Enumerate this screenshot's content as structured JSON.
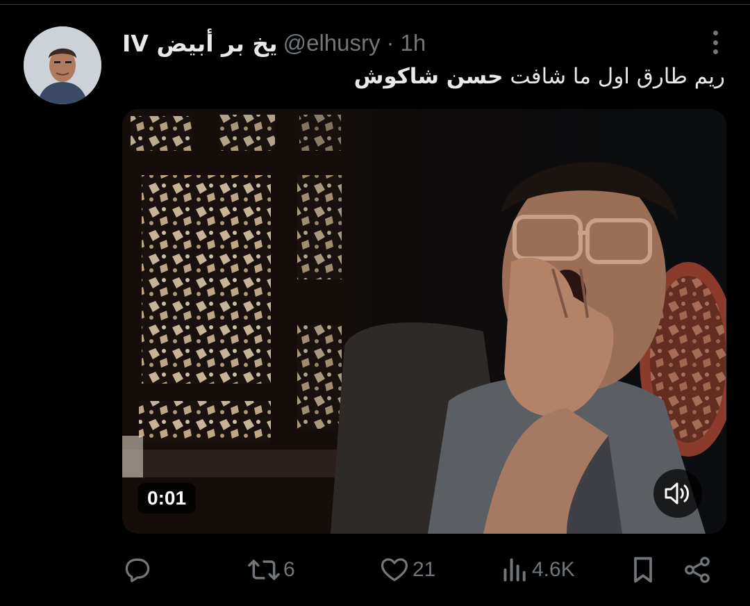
{
  "tweet": {
    "display_name": "یخ بر أبیض IV",
    "handle": "@elhusry",
    "separator": "·",
    "time": "1h",
    "text_plain": "ريم طارق اول ما شافت ",
    "text_bold": "حسن شاكوش"
  },
  "video": {
    "timestamp": "0:01"
  },
  "actions": {
    "reply_count": "",
    "retweet_count": "6",
    "like_count": "21",
    "view_count": "4.6K"
  },
  "colors": {
    "background": "#000000",
    "text_primary": "#e7e9ea",
    "text_secondary": "#71767b"
  },
  "icons": {
    "reply": "speech-bubble-icon",
    "retweet": "retweet-arrows-icon",
    "like": "heart-icon",
    "views": "bar-chart-icon",
    "bookmark": "bookmark-icon",
    "share": "share-icon",
    "more": "more-dots-icon",
    "mute": "speaker-icon"
  }
}
